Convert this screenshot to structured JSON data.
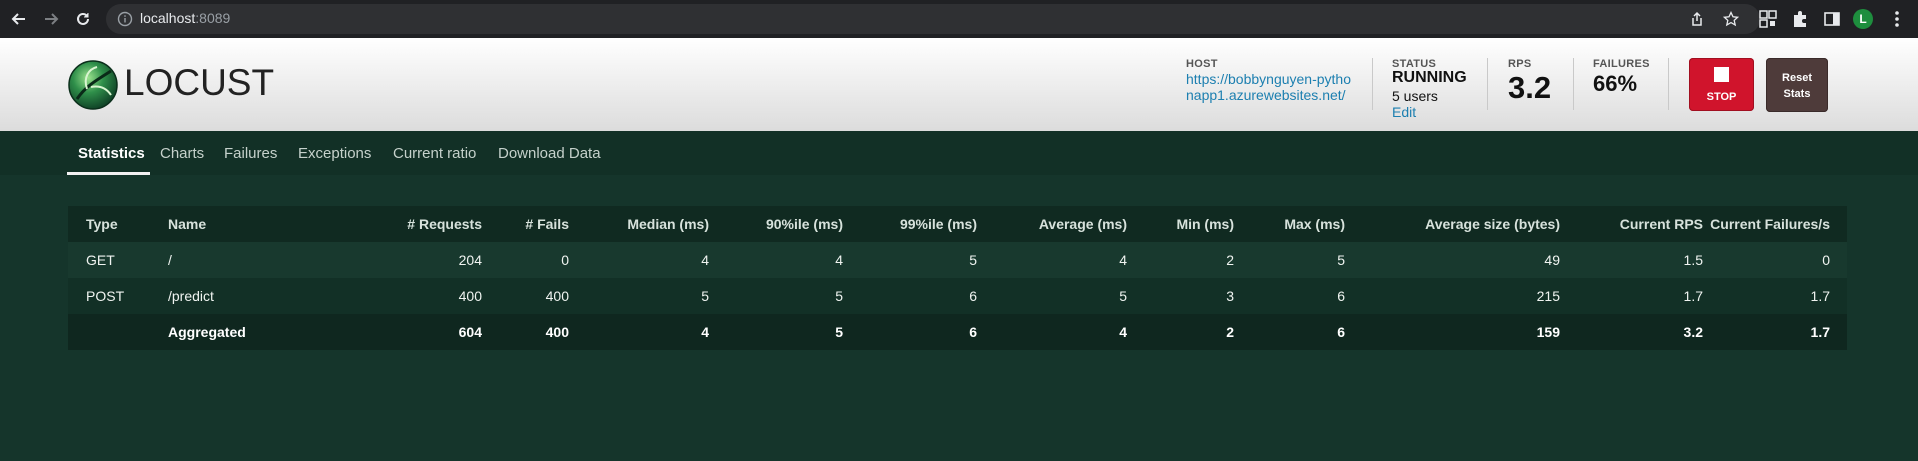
{
  "browser": {
    "url_host": "localhost",
    "url_port": ":8089",
    "avatar_letter": "L"
  },
  "header": {
    "logo_text": "LOCUST",
    "host_label": "HOST",
    "host_value": "https://bobbynguyen-pythonapp1.azurewebsites.net/",
    "status_label": "STATUS",
    "status_value": "RUNNING",
    "users_value": "5 users",
    "edit_label": "Edit",
    "rps_label": "RPS",
    "rps_value": "3.2",
    "failures_label": "FAILURES",
    "failures_value": "66%",
    "stop_label": "STOP",
    "reset_label_line1": "Reset",
    "reset_label_line2": "Stats",
    "colors": {
      "stop": "#d0142c",
      "reset": "#4e3b3a",
      "link": "#1c7fb0"
    }
  },
  "tabs": [
    {
      "label": "Statistics",
      "active": true
    },
    {
      "label": "Charts",
      "active": false
    },
    {
      "label": "Failures",
      "active": false
    },
    {
      "label": "Exceptions",
      "active": false
    },
    {
      "label": "Current ratio",
      "active": false
    },
    {
      "label": "Download Data",
      "active": false
    }
  ],
  "table": {
    "headers": [
      "Type",
      "Name",
      "# Requests",
      "# Fails",
      "Median (ms)",
      "90%ile (ms)",
      "99%ile (ms)",
      "Average (ms)",
      "Min (ms)",
      "Max (ms)",
      "Average size (bytes)",
      "Current RPS",
      "Current Failures/s"
    ],
    "rows": [
      [
        "GET",
        "/",
        "204",
        "0",
        "4",
        "4",
        "5",
        "4",
        "2",
        "5",
        "49",
        "1.5",
        "0"
      ],
      [
        "POST",
        "/predict",
        "400",
        "400",
        "5",
        "5",
        "6",
        "5",
        "3",
        "6",
        "215",
        "1.7",
        "1.7"
      ],
      [
        "",
        "Aggregated",
        "604",
        "400",
        "4",
        "5",
        "6",
        "4",
        "2",
        "6",
        "159",
        "3.2",
        "1.7"
      ]
    ]
  }
}
